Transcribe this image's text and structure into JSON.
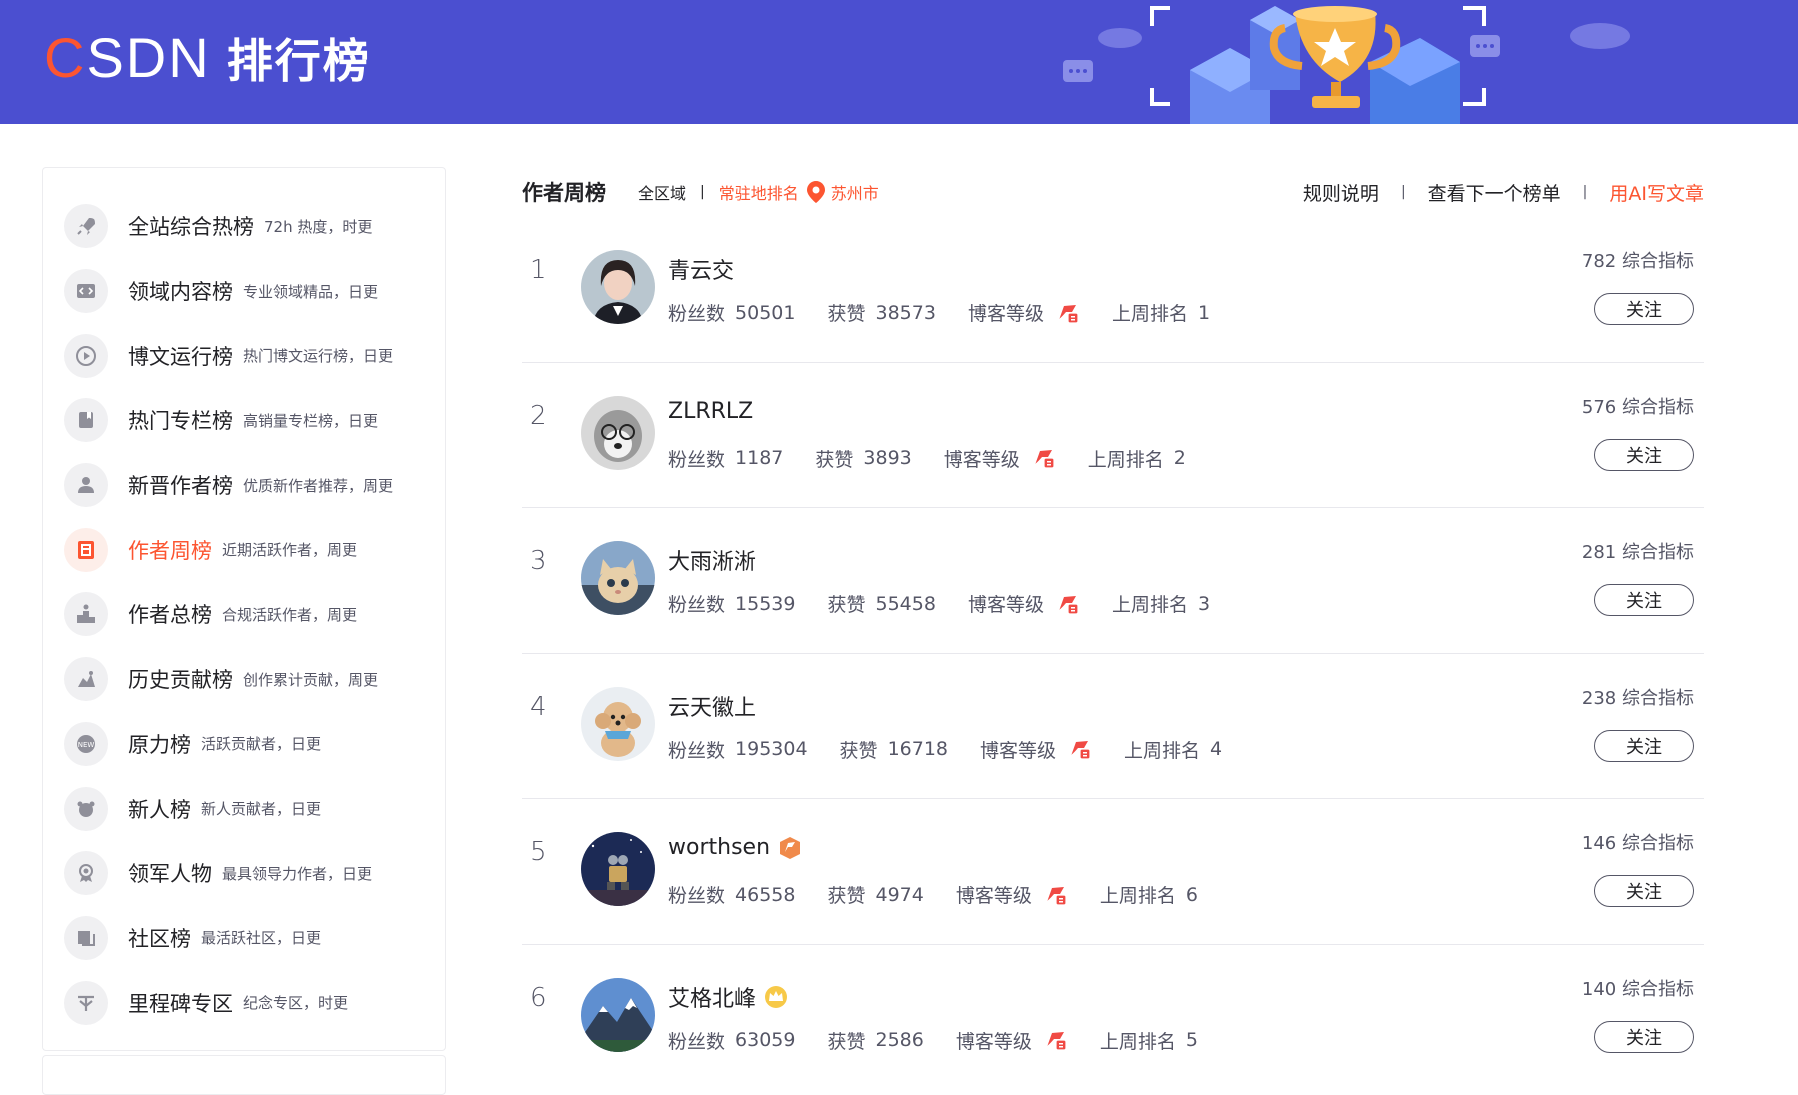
{
  "header": {
    "logo_c": "C",
    "logo_rest": "SDN",
    "title": "排行榜"
  },
  "sidebar": {
    "items": [
      {
        "label": "全站综合热榜",
        "desc": "72h 热度，时更",
        "icon": "rocket-icon",
        "active": false
      },
      {
        "label": "领域内容榜",
        "desc": "专业领域精品，日更",
        "icon": "code-icon",
        "active": false
      },
      {
        "label": "博文运行榜",
        "desc": "热门博文运行榜，日更",
        "icon": "play-icon",
        "active": false
      },
      {
        "label": "热门专栏榜",
        "desc": "高销量专栏榜，日更",
        "icon": "book-icon",
        "active": false
      },
      {
        "label": "新晋作者榜",
        "desc": "优质新作者推荐，周更",
        "icon": "user-icon",
        "active": false
      },
      {
        "label": "作者周榜",
        "desc": "近期活跃作者，周更",
        "icon": "week-icon",
        "active": true
      },
      {
        "label": "作者总榜",
        "desc": "合规活跃作者，周更",
        "icon": "podium-icon",
        "active": false
      },
      {
        "label": "历史贡献榜",
        "desc": "创作累计贡献，周更",
        "icon": "history-icon",
        "active": false
      },
      {
        "label": "原力榜",
        "desc": "活跃贡献者，日更",
        "icon": "power-icon",
        "active": false
      },
      {
        "label": "新人榜",
        "desc": "新人贡献者，日更",
        "icon": "newbie-icon",
        "active": false
      },
      {
        "label": "领军人物",
        "desc": "最具领导力作者，日更",
        "icon": "medal-icon",
        "active": false
      },
      {
        "label": "社区榜",
        "desc": "最活跃社区，日更",
        "icon": "community-icon",
        "active": false
      },
      {
        "label": "里程碑专区",
        "desc": "纪念专区，时更",
        "icon": "milestone-icon",
        "active": false
      }
    ]
  },
  "main": {
    "title": "作者周榜",
    "region_all": "全区域",
    "region_resident": "常驻地排名",
    "city": "苏州市",
    "links": {
      "rules": "规则说明",
      "next": "查看下一个榜单",
      "ai": "用AI写文章"
    },
    "labels": {
      "fans": "粉丝数",
      "likes": "获赞",
      "level": "博客等级",
      "last_rank": "上周排名",
      "score_suffix": "综合指标",
      "follow": "关注"
    },
    "rows": [
      {
        "rank": "1",
        "name": "青云交",
        "fans": "50501",
        "likes": "38573",
        "last_rank": "1",
        "score": "782",
        "badge": "",
        "avatar": "portrait"
      },
      {
        "rank": "2",
        "name": "ZLRRLZ",
        "fans": "1187",
        "likes": "3893",
        "last_rank": "2",
        "score": "576",
        "badge": "",
        "avatar": "dog"
      },
      {
        "rank": "3",
        "name": "大雨淅淅",
        "fans": "15539",
        "likes": "55458",
        "last_rank": "3",
        "score": "281",
        "badge": "",
        "avatar": "cat"
      },
      {
        "rank": "4",
        "name": "云天徽上",
        "fans": "195304",
        "likes": "16718",
        "last_rank": "4",
        "score": "238",
        "badge": "",
        "avatar": "poodle"
      },
      {
        "rank": "5",
        "name": "worthsen",
        "fans": "46558",
        "likes": "4974",
        "last_rank": "6",
        "score": "146",
        "badge": "orange-badge-icon",
        "avatar": "robot"
      },
      {
        "rank": "6",
        "name": "艾格北峰",
        "fans": "63059",
        "likes": "2586",
        "last_rank": "5",
        "score": "140",
        "badge": "crown-badge-icon",
        "avatar": "mountain"
      }
    ]
  },
  "colors": {
    "banner": "#4b4fd0",
    "accent": "#fc5531",
    "text": "#222226",
    "muted": "#555666"
  }
}
